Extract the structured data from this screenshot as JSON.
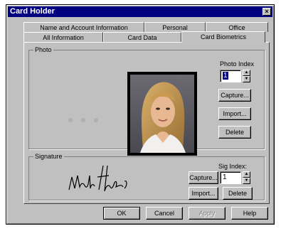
{
  "window": {
    "title": "Card Holder",
    "close_glyph": "×"
  },
  "tabs": {
    "back_row": [
      "Name and Account Information",
      "Personal",
      "Office"
    ],
    "front_row": [
      "All Information",
      "Card Data",
      "Card Biometrics"
    ],
    "active": "Card Biometrics"
  },
  "photo": {
    "group_label": "Photo",
    "index_label": "Photo Index",
    "index_value": "1",
    "capture_label": "Capture...",
    "import_label": "Import...",
    "delete_label": "Delete"
  },
  "signature": {
    "group_label": "Signature",
    "index_label": "Sig Index:",
    "index_value": "1",
    "capture_label": "Capture...",
    "import_label": "Import...",
    "delete_label": "Delete"
  },
  "footer": {
    "ok_label": "OK",
    "cancel_label": "Cancel",
    "apply_label": "Apply",
    "help_label": "Help"
  },
  "icons": {
    "close": "close-icon",
    "spin_up": "spin-up-icon",
    "spin_down": "spin-down-icon"
  },
  "colors": {
    "title_bar": "#000080",
    "face": "#c0c0c0",
    "selection": "#000080"
  }
}
